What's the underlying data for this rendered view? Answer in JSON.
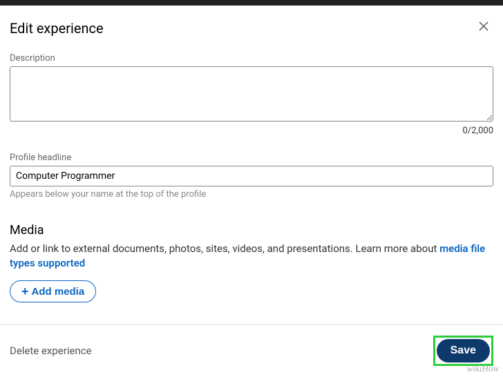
{
  "header": {
    "title": "Edit experience"
  },
  "description": {
    "label": "Description",
    "value": "",
    "char_count": "0/2,000"
  },
  "headline": {
    "label": "Profile headline",
    "value": "Computer Programmer",
    "helper": "Appears below your name at the top of the profile"
  },
  "media": {
    "heading": "Media",
    "text_prefix": "Add or link to external documents, photos, sites, videos, and presentations. Learn more about ",
    "link_text": "media file types supported",
    "add_button": "Add media"
  },
  "footer": {
    "delete": "Delete experience",
    "save": "Save"
  },
  "watermark": "wikiHow"
}
